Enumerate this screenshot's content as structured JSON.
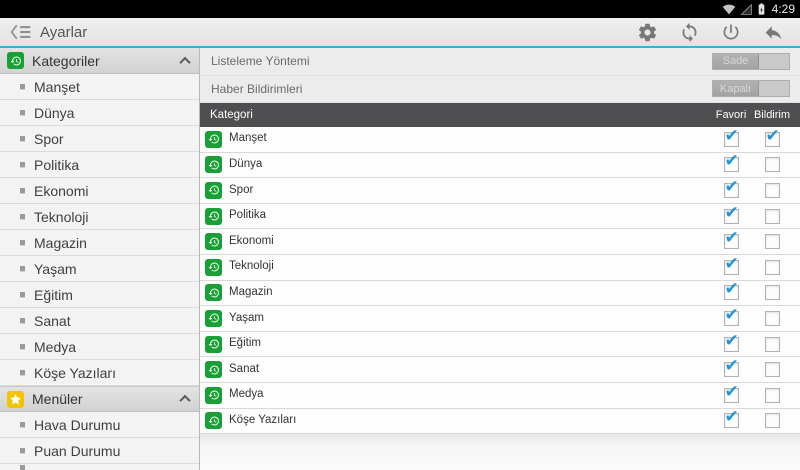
{
  "status_bar": {
    "time": "4:29",
    "icons": [
      "wifi-icon",
      "signal-triangle-icon",
      "battery-icon"
    ]
  },
  "action_bar": {
    "title": "Ayarlar",
    "icons": [
      "drawer-up-icon",
      "gear-icon",
      "refresh-icon",
      "power-icon",
      "back-arrow-icon"
    ]
  },
  "sidebar": {
    "sections": [
      {
        "label": "Kategoriler",
        "icon": "history-icon",
        "items": [
          "Manşet",
          "Dünya",
          "Spor",
          "Politika",
          "Ekonomi",
          "Teknoloji",
          "Magazin",
          "Yaşam",
          "Eğitim",
          "Sanat",
          "Medya",
          "Köşe Yazıları"
        ]
      },
      {
        "label": "Menüler",
        "icon": "star-icon",
        "items": [
          "Hava Durumu",
          "Puan Durumu"
        ]
      }
    ]
  },
  "settings": {
    "rows": [
      {
        "label": "Listeleme Yöntemi",
        "value": "Sade"
      },
      {
        "label": "Haber Bildirimleri",
        "value": "Kapalı"
      }
    ]
  },
  "table": {
    "headers": {
      "category": "Kategori",
      "favorite": "Favori",
      "notification": "Bildirim"
    },
    "rows": [
      {
        "label": "Manşet",
        "favori": true,
        "bildirim": true
      },
      {
        "label": "Dünya",
        "favori": true,
        "bildirim": false
      },
      {
        "label": "Spor",
        "favori": true,
        "bildirim": false
      },
      {
        "label": "Politika",
        "favori": true,
        "bildirim": false
      },
      {
        "label": "Ekonomi",
        "favori": true,
        "bildirim": false
      },
      {
        "label": "Teknoloji",
        "favori": true,
        "bildirim": false
      },
      {
        "label": "Magazin",
        "favori": true,
        "bildirim": false
      },
      {
        "label": "Yaşam",
        "favori": true,
        "bildirim": false
      },
      {
        "label": "Eğitim",
        "favori": true,
        "bildirim": false
      },
      {
        "label": "Sanat",
        "favori": true,
        "bildirim": false
      },
      {
        "label": "Medya",
        "favori": true,
        "bildirim": false
      },
      {
        "label": "Köşe Yazıları",
        "favori": true,
        "bildirim": false
      }
    ]
  },
  "colors": {
    "accent_blue": "#2eb3e4",
    "check_blue": "#2196d3",
    "category_green": "#17a033",
    "menu_yellow": "#f2c500",
    "table_header_gray": "#4f4f51"
  }
}
